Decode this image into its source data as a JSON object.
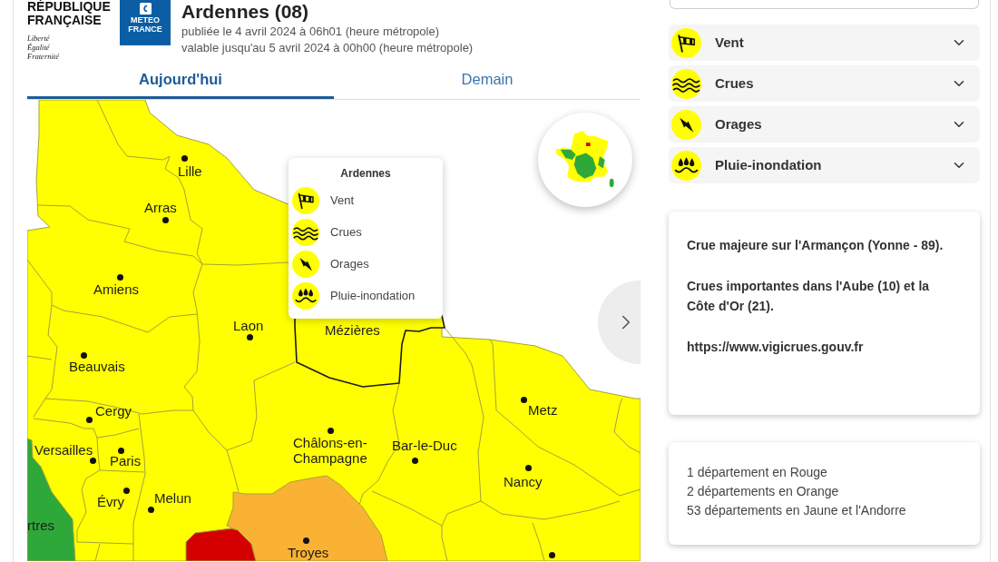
{
  "header": {
    "emblem_lines": [
      "RÉPUBLIQUE",
      "FRANÇAISE"
    ],
    "motto": [
      "Liberté",
      "Égalité",
      "Fraternité"
    ],
    "partner_logo": [
      "METEO",
      "FRANCE"
    ],
    "title": "Ardennes (08)",
    "published": "publiée le 4 avril 2024 à 06h01 (heure métropole)",
    "valid_until": "valable jusqu'au 5 avril 2024 à 00h00 (heure métropole)"
  },
  "tabs": [
    {
      "label": "Aujourd'hui",
      "selected": true
    },
    {
      "label": "Demain",
      "selected": false
    }
  ],
  "map": {
    "areas": [
      {
        "color": "#ffff00",
        "selected": false
      },
      {
        "color": "#ffff00",
        "selected": true
      },
      {
        "color": "#2fa83a",
        "selected": false
      },
      {
        "color": "#f9b233",
        "selected": false
      },
      {
        "color": "#d40000",
        "selected": false
      }
    ],
    "cities": [
      {
        "name": "Lille"
      },
      {
        "name": "Arras"
      },
      {
        "name": "Amiens"
      },
      {
        "name": "Laon"
      },
      {
        "name": "Mézières"
      },
      {
        "name": "Beauvais"
      },
      {
        "name": "Metz"
      },
      {
        "name": "Cergy"
      },
      {
        "name": "Châlons-en-Champagne"
      },
      {
        "name": "Bar-le-Duc"
      },
      {
        "name": "Versailles"
      },
      {
        "name": "Paris"
      },
      {
        "name": "Nancy"
      },
      {
        "name": "Melun"
      },
      {
        "name": "Évry"
      },
      {
        "name": "rtres"
      },
      {
        "name": "Troyes"
      }
    ],
    "tooltip": {
      "title": "Ardennes",
      "items": [
        {
          "kind": "wind",
          "label": "Vent"
        },
        {
          "kind": "flood",
          "label": "Crues"
        },
        {
          "kind": "storm",
          "label": "Orages"
        },
        {
          "kind": "rain-flood",
          "label": "Pluie-inondation"
        }
      ]
    }
  },
  "hazards": [
    {
      "kind": "wind",
      "label": "Vent",
      "expanded": false
    },
    {
      "kind": "flood",
      "label": "Crues",
      "expanded": false
    },
    {
      "kind": "storm",
      "label": "Orages",
      "expanded": false
    },
    {
      "kind": "rain-flood",
      "label": "Pluie-inondation",
      "expanded": false
    }
  ],
  "notice": [
    "Crue majeure sur l'Armançon (Yonne - 89).",
    "Crues importantes dans l'Aube (10) et la Côte d'Or (21).",
    "https://www.vigicrues.gouv.fr"
  ],
  "summary": [
    "1 département en Rouge",
    "2 départements en Orange",
    "53 départements en Jaune et l'Andorre"
  ]
}
